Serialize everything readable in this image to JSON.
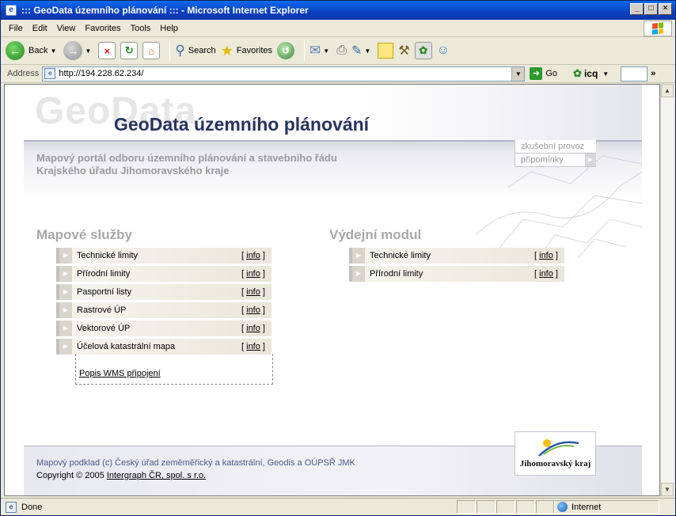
{
  "window": {
    "title": "::: GeoData územního plánování ::: - Microsoft Internet Explorer",
    "controls": [
      "_",
      "□",
      "×"
    ]
  },
  "menu": [
    "File",
    "Edit",
    "View",
    "Favorites",
    "Tools",
    "Help"
  ],
  "toolbar": {
    "back": "Back",
    "search": "Search",
    "favorites": "Favorites"
  },
  "address": {
    "label": "Address",
    "url": "http://194.228.62.234/",
    "go": "Go",
    "icq": "icq",
    "more": "»"
  },
  "page": {
    "ghost_logo": "GeoData",
    "title": "GeoData územního plánování",
    "subtitle_line1": "Mapový portál odboru územního plánování a stavebního řádu",
    "subtitle_line2": "Krajského úřadu Jihomoravského kraje",
    "side_links": [
      {
        "label": "zkušební provoz"
      },
      {
        "label": "připomínky"
      }
    ],
    "left_section": {
      "heading": "Mapové služby",
      "items": [
        {
          "label": "Technické limity",
          "info": "info"
        },
        {
          "label": "Přírodní limity",
          "info": "info"
        },
        {
          "label": "Pasportní listy",
          "info": "info"
        },
        {
          "label": "Rastrové ÚP",
          "info": "info"
        },
        {
          "label": "Vektorové ÚP",
          "info": "info"
        },
        {
          "label": "Účelová katastrální mapa",
          "info": "info"
        }
      ],
      "wms_link": "Popis WMS připojení"
    },
    "right_section": {
      "heading": "Výdejní modul",
      "items": [
        {
          "label": "Technické limity",
          "info": "info"
        },
        {
          "label": "Přírodní limity",
          "info": "info"
        }
      ]
    },
    "footer": {
      "line1": "Mapový podklad (c) Český úřad zeměměřický a katastrální, Geodis a OÚPSŘ JMK",
      "line2_prefix": "Copyright © 2005 ",
      "line2_link": "Intergraph ČR, spol. s r.o.",
      "logo_text": "Jihomoravský kraj"
    }
  },
  "status": {
    "text": "Done",
    "zone": "Internet"
  },
  "colors": {
    "title_blue": "#27335f",
    "subtitle_grey": "#9a9a9e",
    "footer_blue": "#4c5a8e",
    "titlebar_blue": "#0a3fbf"
  }
}
